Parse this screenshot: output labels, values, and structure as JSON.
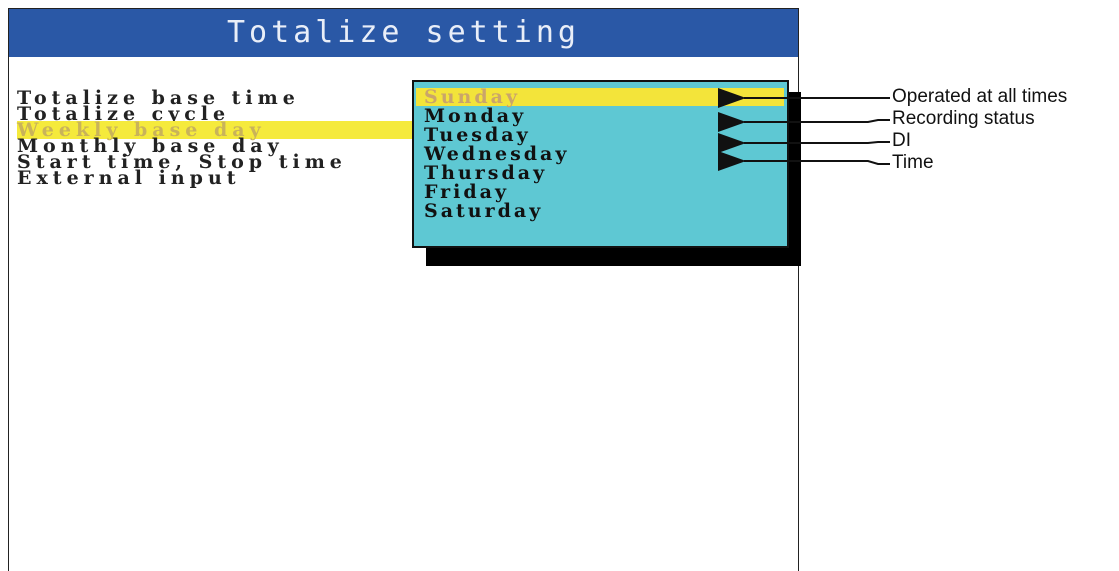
{
  "window": {
    "title": "Totalize setting"
  },
  "menu": {
    "items": [
      {
        "label": "Totalize base time"
      },
      {
        "label": "Totalize cycle"
      },
      {
        "label": "Weekly base day",
        "highlighted": true
      },
      {
        "label": "Monthly base day"
      },
      {
        "label": "Start time, Stop time"
      },
      {
        "label": "External input"
      }
    ],
    "colon": ":"
  },
  "dropdown": {
    "options": [
      "Sunday",
      "Monday",
      "Tuesday",
      "Wednesday",
      "Thursday",
      "Friday",
      "Saturday"
    ],
    "selected": "Sunday",
    "background_color": "#5ec8d3",
    "highlight_color": "#f3e43a"
  },
  "annotations": [
    {
      "label": "Operated at all times"
    },
    {
      "label": "Recording status"
    },
    {
      "label": "DI"
    },
    {
      "label": "Time"
    }
  ],
  "colors": {
    "titlebar": "#2a58a6",
    "menu_highlight": "#f5ea3c"
  }
}
